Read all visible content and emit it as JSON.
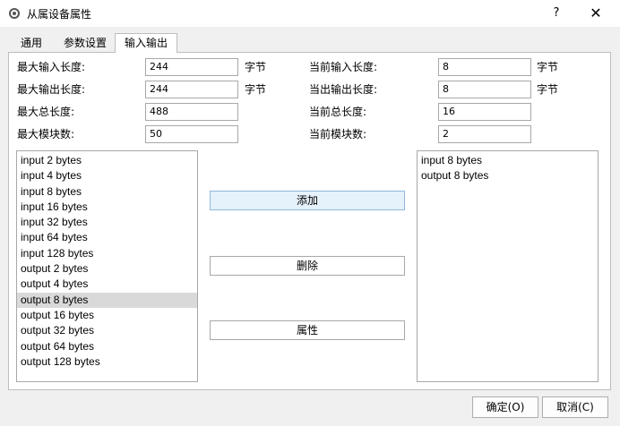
{
  "window": {
    "title": "从属设备属性",
    "help_label": "?",
    "close_label": "✕",
    "icon": "gear-icon"
  },
  "tabs": [
    {
      "label": "通用"
    },
    {
      "label": "参数设置"
    },
    {
      "label": "输入输出",
      "active": true
    }
  ],
  "limits": {
    "max_input_label": "最大输入长度:",
    "max_input_value": "244",
    "max_input_unit": "字节",
    "max_output_label": "最大输出长度:",
    "max_output_value": "244",
    "max_output_unit": "字节",
    "max_total_label": "最大总长度:",
    "max_total_value": "488",
    "max_modules_label": "最大模块数:",
    "max_modules_value": "50"
  },
  "current": {
    "input_label": "当前输入长度:",
    "input_value": "8",
    "input_unit": "字节",
    "output_label": "当出输出长度:",
    "output_value": "8",
    "output_unit": "字节",
    "total_label": "当前总长度:",
    "total_value": "16",
    "modules_label": "当前模块数:",
    "modules_value": "2"
  },
  "available_modules": [
    "input 2 bytes",
    "input 4 bytes",
    "input 8 bytes",
    "input 16 bytes",
    "input 32 bytes",
    "input 64 bytes",
    "input 128 bytes",
    "output 2 bytes",
    "output 4 bytes",
    "output 8 bytes",
    "output 16 bytes",
    "output 32 bytes",
    "output 64 bytes",
    "output 128 bytes"
  ],
  "selected_available_index": 9,
  "configured_modules": [
    "input 8 bytes",
    "output 8 bytes"
  ],
  "actions": {
    "add_label": "添加",
    "delete_label": "删除",
    "properties_label": "属性"
  },
  "footer": {
    "ok_label": "确定(O)",
    "cancel_label": "取消(C)"
  },
  "colors": {
    "selection": "#d9d9d9",
    "focused_button": "#e5f1fb"
  }
}
